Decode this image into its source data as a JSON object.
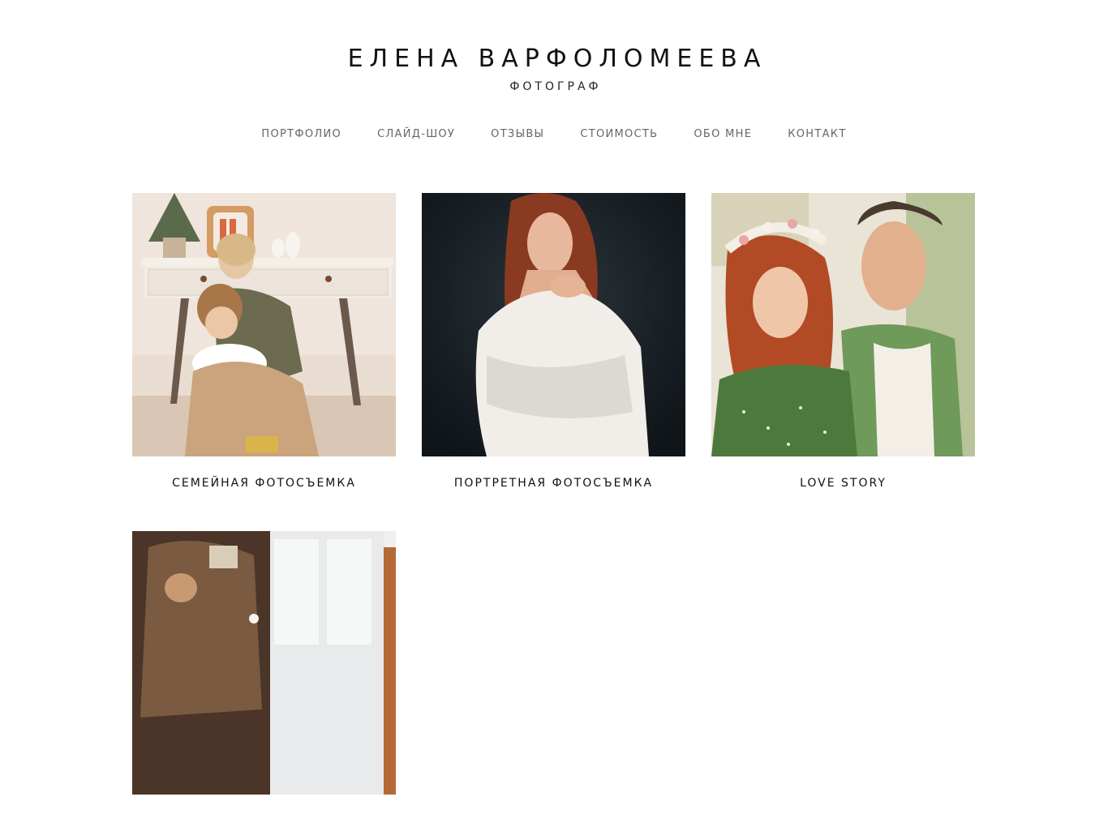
{
  "header": {
    "title": "ЕЛЕНА ВАРФОЛОМЕЕВА",
    "subtitle": "ФОТОГРАФ"
  },
  "nav": {
    "items": [
      {
        "label": "ПОРТФОЛИО"
      },
      {
        "label": "СЛАЙД-ШОУ"
      },
      {
        "label": "ОТЗЫВЫ"
      },
      {
        "label": "СТОИМОСТЬ"
      },
      {
        "label": "ОБО МНЕ"
      },
      {
        "label": "КОНТАКТ"
      }
    ]
  },
  "gallery": {
    "items": [
      {
        "caption": "СЕМЕЙНАЯ ФОТОСЪЕМКА"
      },
      {
        "caption": "ПОРТРЕТНАЯ ФОТОСЪЕМКА"
      },
      {
        "caption": "LOVE STORY"
      },
      {
        "caption": ""
      }
    ]
  },
  "colors": {
    "text": "#111111",
    "nav_text": "#666666",
    "background": "#ffffff"
  }
}
